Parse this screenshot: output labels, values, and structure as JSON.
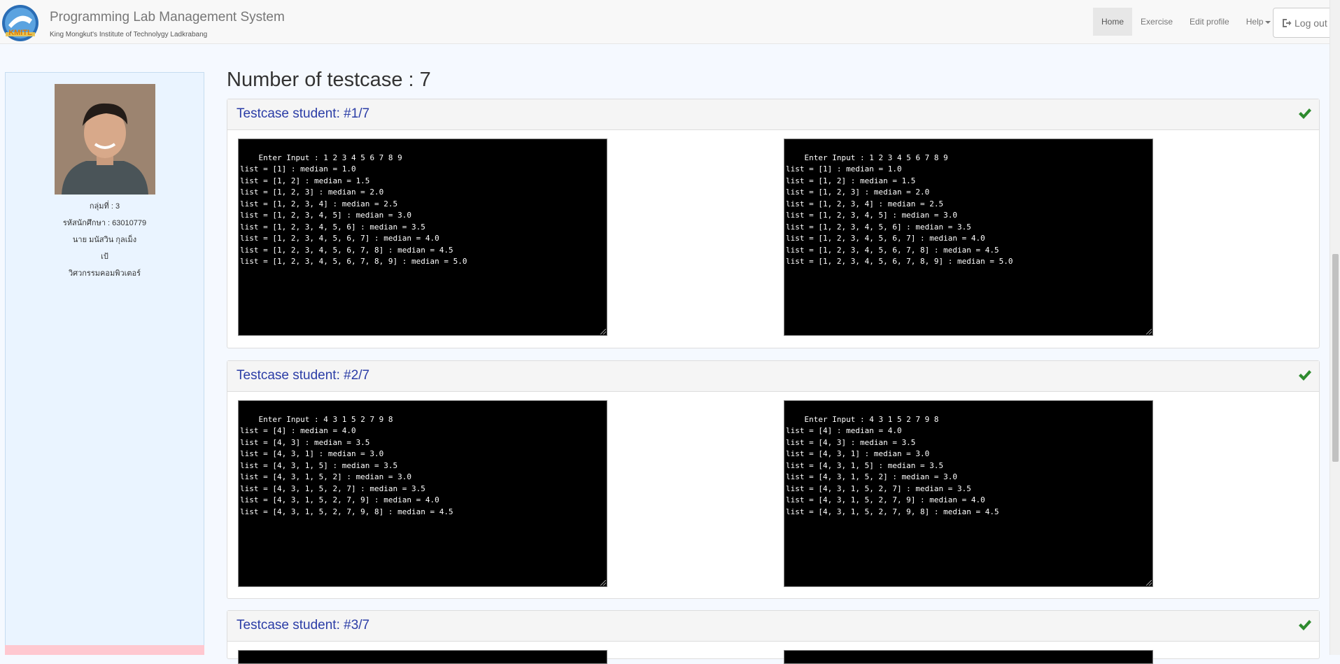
{
  "header": {
    "title": "Programming Lab Management System",
    "subtitle": "King Mongkut's Institute of Technolygy Ladkrabang",
    "logo_text": "KMITL",
    "nav": {
      "home": "Home",
      "exercise": "Exercise",
      "edit_profile": "Edit profile",
      "help": "Help"
    },
    "logout": "Log out"
  },
  "profile": {
    "group": "กลุ่มที่ : 3",
    "student_id": "รหัสนักศึกษา : 63010779",
    "name": "นาย มนัสวิน กุลเม็ง",
    "nickname": "เป้",
    "department": "วิศวกรรมคอมพิวเตอร์"
  },
  "main": {
    "title": "Number of testcase : 7",
    "testcases": [
      {
        "title": "Testcase student: #1/7",
        "student_output": "Enter Input : 1 2 3 4 5 6 7 8 9\nlist = [1] : median = 1.0\nlist = [1, 2] : median = 1.5\nlist = [1, 2, 3] : median = 2.0\nlist = [1, 2, 3, 4] : median = 2.5\nlist = [1, 2, 3, 4, 5] : median = 3.0\nlist = [1, 2, 3, 4, 5, 6] : median = 3.5\nlist = [1, 2, 3, 4, 5, 6, 7] : median = 4.0\nlist = [1, 2, 3, 4, 5, 6, 7, 8] : median = 4.5\nlist = [1, 2, 3, 4, 5, 6, 7, 8, 9] : median = 5.0",
        "expected_output": "Enter Input : 1 2 3 4 5 6 7 8 9\nlist = [1] : median = 1.0\nlist = [1, 2] : median = 1.5\nlist = [1, 2, 3] : median = 2.0\nlist = [1, 2, 3, 4] : median = 2.5\nlist = [1, 2, 3, 4, 5] : median = 3.0\nlist = [1, 2, 3, 4, 5, 6] : median = 3.5\nlist = [1, 2, 3, 4, 5, 6, 7] : median = 4.0\nlist = [1, 2, 3, 4, 5, 6, 7, 8] : median = 4.5\nlist = [1, 2, 3, 4, 5, 6, 7, 8, 9] : median = 5.0"
      },
      {
        "title": "Testcase student: #2/7",
        "student_output": "Enter Input : 4 3 1 5 2 7 9 8\nlist = [4] : median = 4.0\nlist = [4, 3] : median = 3.5\nlist = [4, 3, 1] : median = 3.0\nlist = [4, 3, 1, 5] : median = 3.5\nlist = [4, 3, 1, 5, 2] : median = 3.0\nlist = [4, 3, 1, 5, 2, 7] : median = 3.5\nlist = [4, 3, 1, 5, 2, 7, 9] : median = 4.0\nlist = [4, 3, 1, 5, 2, 7, 9, 8] : median = 4.5",
        "expected_output": "Enter Input : 4 3 1 5 2 7 9 8\nlist = [4] : median = 4.0\nlist = [4, 3] : median = 3.5\nlist = [4, 3, 1] : median = 3.0\nlist = [4, 3, 1, 5] : median = 3.5\nlist = [4, 3, 1, 5, 2] : median = 3.0\nlist = [4, 3, 1, 5, 2, 7] : median = 3.5\nlist = [4, 3, 1, 5, 2, 7, 9] : median = 4.0\nlist = [4, 3, 1, 5, 2, 7, 9, 8] : median = 4.5"
      },
      {
        "title": "Testcase student: #3/7",
        "student_output": "",
        "expected_output": ""
      }
    ]
  },
  "colors": {
    "panel_title": "#2b3da6",
    "check": "#2e8b2e",
    "sidebar_bg": "#eaf4ff"
  },
  "icons": {
    "check": "check-icon",
    "logout": "logout-icon",
    "caret": "caret-down-icon"
  }
}
